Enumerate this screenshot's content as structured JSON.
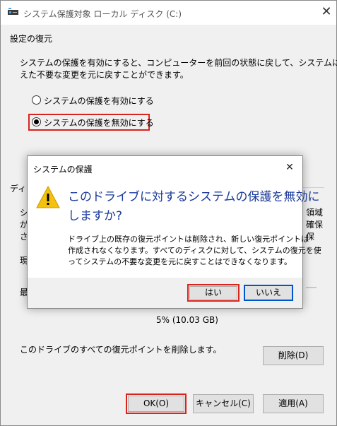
{
  "window": {
    "title": "システム保護対象 ローカル ディスク (C:)",
    "close_glyph": "✕"
  },
  "restore_settings": {
    "group_label": "設定の復元",
    "description_line1": "システムの保護を有効にすると、コンピューターを前回の状態に戻して、システムに加",
    "description_line2": "えた不要な変更を元に戻すことができます。",
    "options": [
      {
        "label": "システムの保護を有効にする",
        "selected": false
      },
      {
        "label": "システムの保護を無効にする",
        "selected": true
      }
    ]
  },
  "disk_usage": {
    "group_label_partial": "ディ",
    "left_fragments": [
      "シ",
      "が",
      "さ"
    ],
    "right_fragments": [
      "領域",
      "確保",
      "保"
    ],
    "current_label_partial": "現",
    "max_label_partial": "最",
    "usage_value": "5% (10.03 GB)",
    "delete_description": "このドライブのすべての復元ポイントを削除します。",
    "delete_button": "削除(D)"
  },
  "footer": {
    "ok_button": "OK(O)",
    "cancel_button": "キャンセル(C)",
    "apply_button": "適用(A)"
  },
  "dialog": {
    "title": "システムの保護",
    "close_glyph": "✕",
    "heading_line1": "このドライブに対するシステムの保護を無効に",
    "heading_line2": "しますか?",
    "body_line1": "ドライブ上の既存の復元ポイントは削除され、新しい復元ポイントは",
    "body_line2": "作成されなくなります。すべてのディスクに対して、システムの復元を使",
    "body_line3": "ってシステムの不要な変更を元に戻すことはできなくなります。",
    "yes_button": "はい",
    "no_button": "いいえ",
    "warning_glyph": "!"
  },
  "colors": {
    "accent_blue": "#0055cc",
    "heading_blue": "#1a3a9c",
    "highlight_red": "#d9241b",
    "warning_yellow": "#f4c20d"
  }
}
